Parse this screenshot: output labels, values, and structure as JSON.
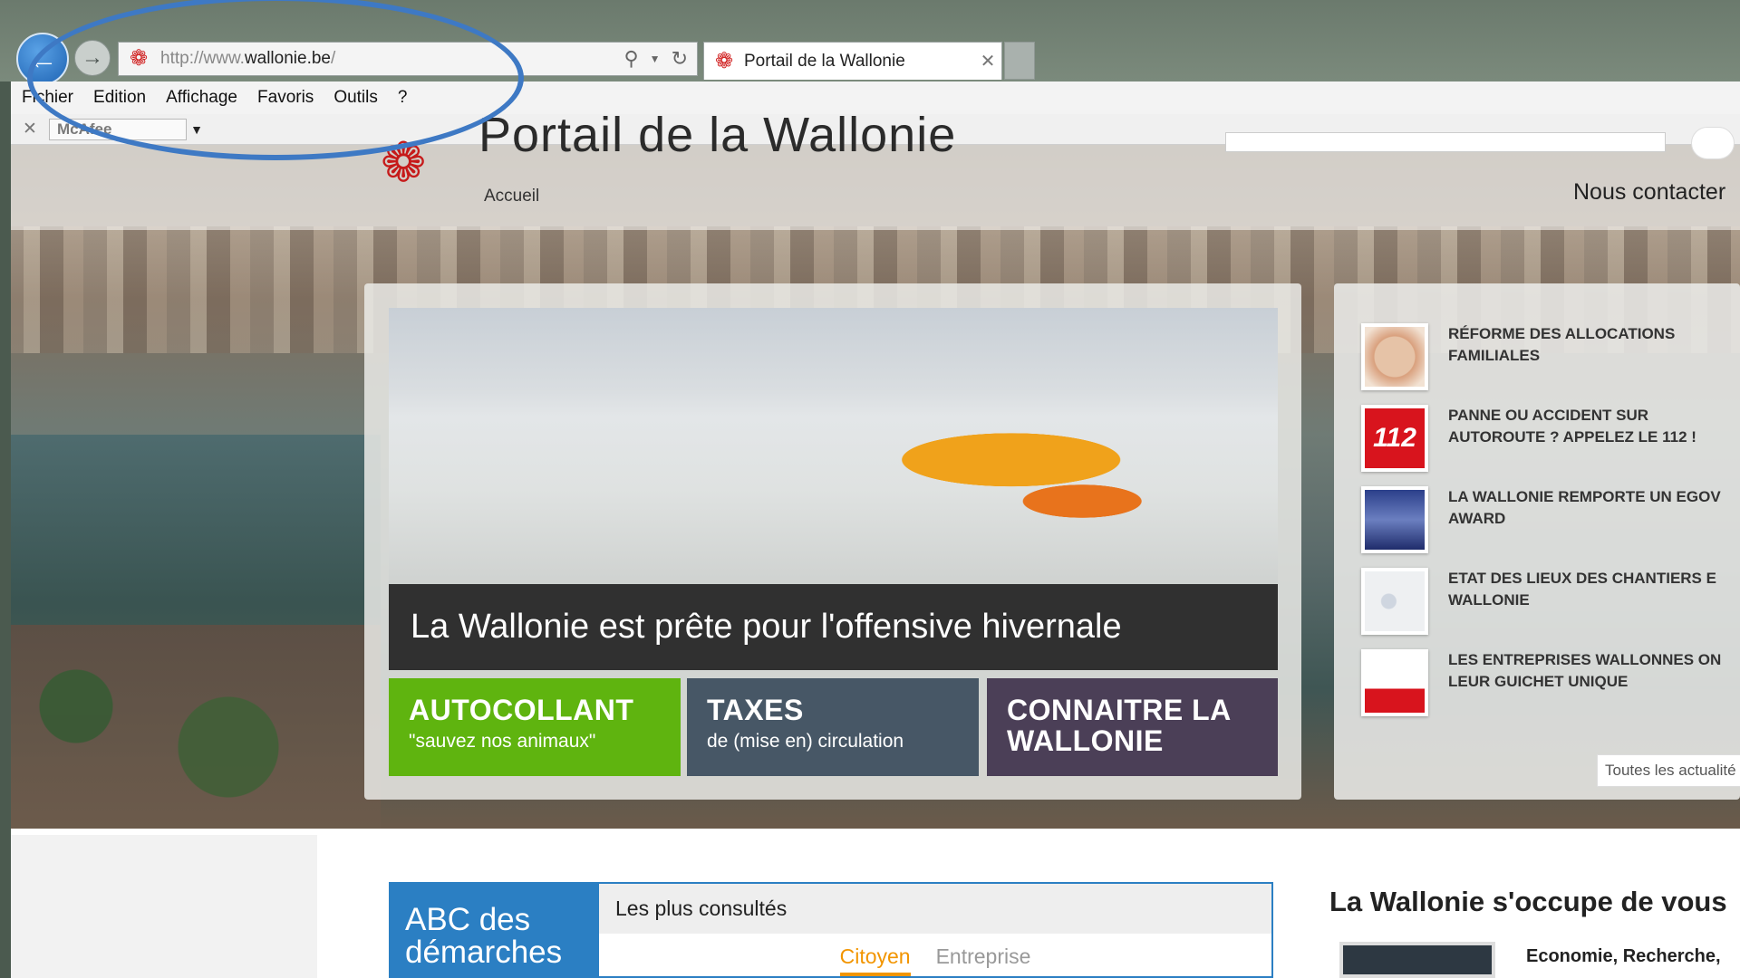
{
  "browser": {
    "url_prefix": "http://www.",
    "url_domain": "wallonie.be",
    "url_suffix": "/",
    "tab_title": "Portail de la Wallonie",
    "menu": [
      "Fichier",
      "Edition",
      "Affichage",
      "Favoris",
      "Outils",
      "?"
    ],
    "toolbar_addon": "McAfee"
  },
  "site": {
    "title": "Portail de la Wallonie",
    "breadcrumb": "Accueil",
    "contact": "Nous contacter"
  },
  "hero": {
    "caption": "La Wallonie est prête pour l'offensive hivernale",
    "tiles": [
      {
        "title": "AUTOCOLLANT",
        "subtitle": "\"sauvez nos animaux\"",
        "color": "#5fb40f"
      },
      {
        "title": "TAXES",
        "subtitle": "de (mise en) circulation",
        "color": "#475766"
      },
      {
        "title": "CONNAITRE LA WALLONIE",
        "subtitle": "",
        "color": "#4b3f57"
      }
    ]
  },
  "news": {
    "items": [
      {
        "text": "RÉFORME DES ALLOCATIONS FAMILIALES"
      },
      {
        "text": "PANNE OU ACCIDENT SUR AUTOROUTE ? APPELEZ LE 112 !",
        "thumb_label": "112"
      },
      {
        "text": "LA WALLONIE REMPORTE UN EGOV AWARD"
      },
      {
        "text": "ETAT DES LIEUX DES CHANTIERS E WALLONIE"
      },
      {
        "text": "LES ENTREPRISES WALLONNES ON LEUR GUICHET UNIQUE"
      }
    ],
    "more_link": "Toutes les actualité"
  },
  "lower": {
    "abc_title": "ABC des démarches",
    "consult_title": "Les plus consultés",
    "tab_active": "Citoyen",
    "tab_inactive": "Entreprise",
    "section_title": "La Wallonie s'occupe de vous",
    "section_item": "Economie, Recherche,"
  },
  "colors": {
    "annotation": "#3e79c4",
    "accent_orange": "#f29500",
    "abc_blue": "#2b7fc3"
  }
}
